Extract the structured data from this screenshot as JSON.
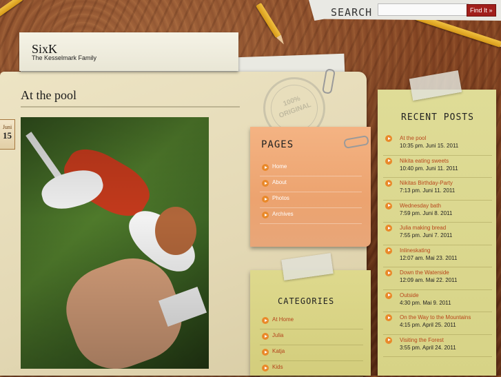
{
  "search": {
    "label": "SEARCH",
    "input_value": "",
    "button_label": "Find It »"
  },
  "header": {
    "site_title": "SixK",
    "tagline": "The Kesselmark Family"
  },
  "post": {
    "title": "At the pool",
    "date_month": "Juni",
    "date_day": "15"
  },
  "stamp": {
    "line1": "100%",
    "line2": "ORIGINAL"
  },
  "pages": {
    "heading": "PAGES",
    "items": [
      {
        "label": "Home"
      },
      {
        "label": "About"
      },
      {
        "label": "Photos"
      },
      {
        "label": "Archives"
      }
    ]
  },
  "categories": {
    "heading": "CATEGORIES",
    "items": [
      {
        "label": "At Home"
      },
      {
        "label": "Julia"
      },
      {
        "label": "Katja"
      },
      {
        "label": "Kids"
      }
    ]
  },
  "recent_posts": {
    "heading": "RECENT POSTS",
    "items": [
      {
        "title": "At the pool",
        "date": "10:35 pm. Juni 15. 2011"
      },
      {
        "title": "Nikita eating sweets",
        "date": "10:40 pm. Juni 11. 2011"
      },
      {
        "title": "Nikitas Birthday-Party",
        "date": "7:13 pm. Juni 11. 2011"
      },
      {
        "title": "Wednesday bath",
        "date": "7:59 pm. Juni 8. 2011"
      },
      {
        "title": "Julia making bread",
        "date": "7:55 pm. Juni 7. 2011"
      },
      {
        "title": "Inlineskating",
        "date": "12:07 am. Mai 23. 2011"
      },
      {
        "title": "Down the Waterside",
        "date": "12:09 am. Mai 22. 2011"
      },
      {
        "title": "Outside",
        "date": "4:30 pm. Mai 9. 2011"
      },
      {
        "title": "On the Way to the Mountains",
        "date": "4:15 pm. April 25. 2011"
      },
      {
        "title": "Visiting the Forest",
        "date": "3:55 pm. April 24. 2011"
      }
    ]
  },
  "colors": {
    "link_orange": "#b8451a",
    "button_red": "#a11f1b",
    "bullet_orange": "#e9892a"
  }
}
